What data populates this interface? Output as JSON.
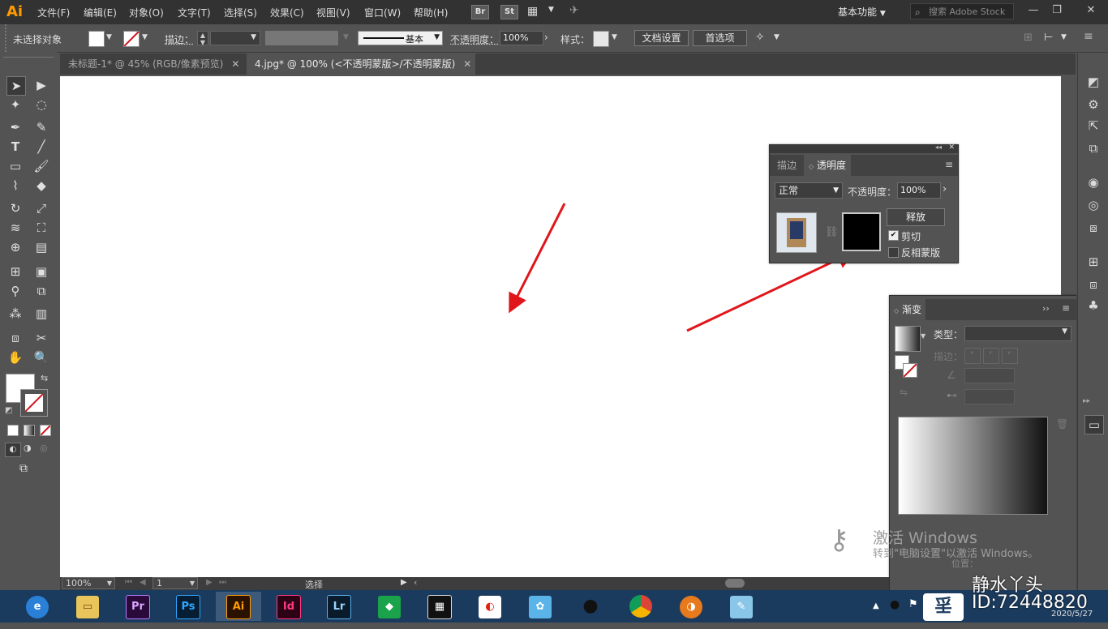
{
  "app": {
    "logo": "Ai"
  },
  "menu": [
    "文件(F)",
    "编辑(E)",
    "对象(O)",
    "文字(T)",
    "选择(S)",
    "效果(C)",
    "视图(V)",
    "窗口(W)",
    "帮助(H)"
  ],
  "menu_badges": [
    "Br",
    "St"
  ],
  "workspace": "基本功能",
  "search_placeholder": "搜索 Adobe Stock",
  "control": {
    "no_selection": "未选择对象",
    "stroke_label": "描边：",
    "brush": "基本",
    "opacity_label": "不透明度：",
    "opacity_value": "100%",
    "style_label": "样式：",
    "doc_setup": "文档设置",
    "preferences": "首选项"
  },
  "tabs": [
    {
      "label": "未标题-1* @ 45% (RGB/像素预览)",
      "active": false
    },
    {
      "label": "4.jpg* @ 100% (<不透明蒙版>/不透明蒙版)",
      "active": true
    }
  ],
  "transparency_panel": {
    "tab_stroke": "描边",
    "tab_transparency": "透明度",
    "blend_mode": "正常",
    "opacity_label": "不透明度：",
    "opacity_value": "100%",
    "release": "释放",
    "clip_label": "剪切",
    "clip_checked": true,
    "invert_label": "反相蒙版",
    "invert_checked": false
  },
  "gradient_panel": {
    "title": "渐变",
    "type_label": "类型：",
    "stroke_label": "描边：",
    "position_label": "位置："
  },
  "status": {
    "zoom": "100%",
    "page": "1",
    "tool": "选择"
  },
  "watermark": {
    "line1": "激活 Windows",
    "line2": "转到\"电脑设置\"以激活 Windows。",
    "brand": "静水丫头",
    "id": "ID:72448820",
    "date": "2020/5/27"
  },
  "taskbar_apps": [
    "Pr",
    "Ps",
    "Ai",
    "Id",
    "Lr"
  ],
  "colors": {
    "ai_orange": "#ff9a00",
    "pr_purple": "#2a0a3a",
    "arrow_red": "#e0161b"
  }
}
